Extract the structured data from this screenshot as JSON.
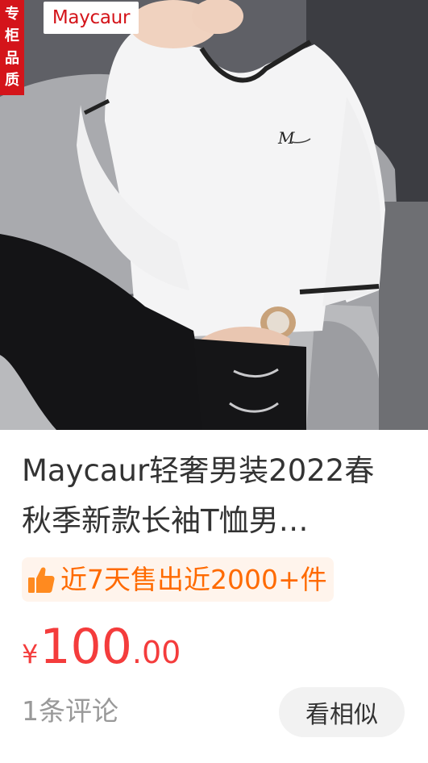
{
  "product": {
    "badge_chars": [
      "专",
      "柜",
      "品",
      "质"
    ],
    "brand_logo_text": "Maycaur",
    "title": "Maycaur轻奢男装2022春秋季新款长袖T恤男…",
    "sales_text": "近7天售出近2000+件",
    "sales_icon": "thumbs-up-icon",
    "price": {
      "currency": "¥",
      "integer": "100",
      "decimal": ".00"
    },
    "reviews": "1条评论",
    "similar_button_label": "看相似"
  },
  "colors": {
    "price": "#f43c3c",
    "sales_text": "#ff6a00",
    "sales_bg": "#fff4ec",
    "badge": "#d4141a"
  }
}
